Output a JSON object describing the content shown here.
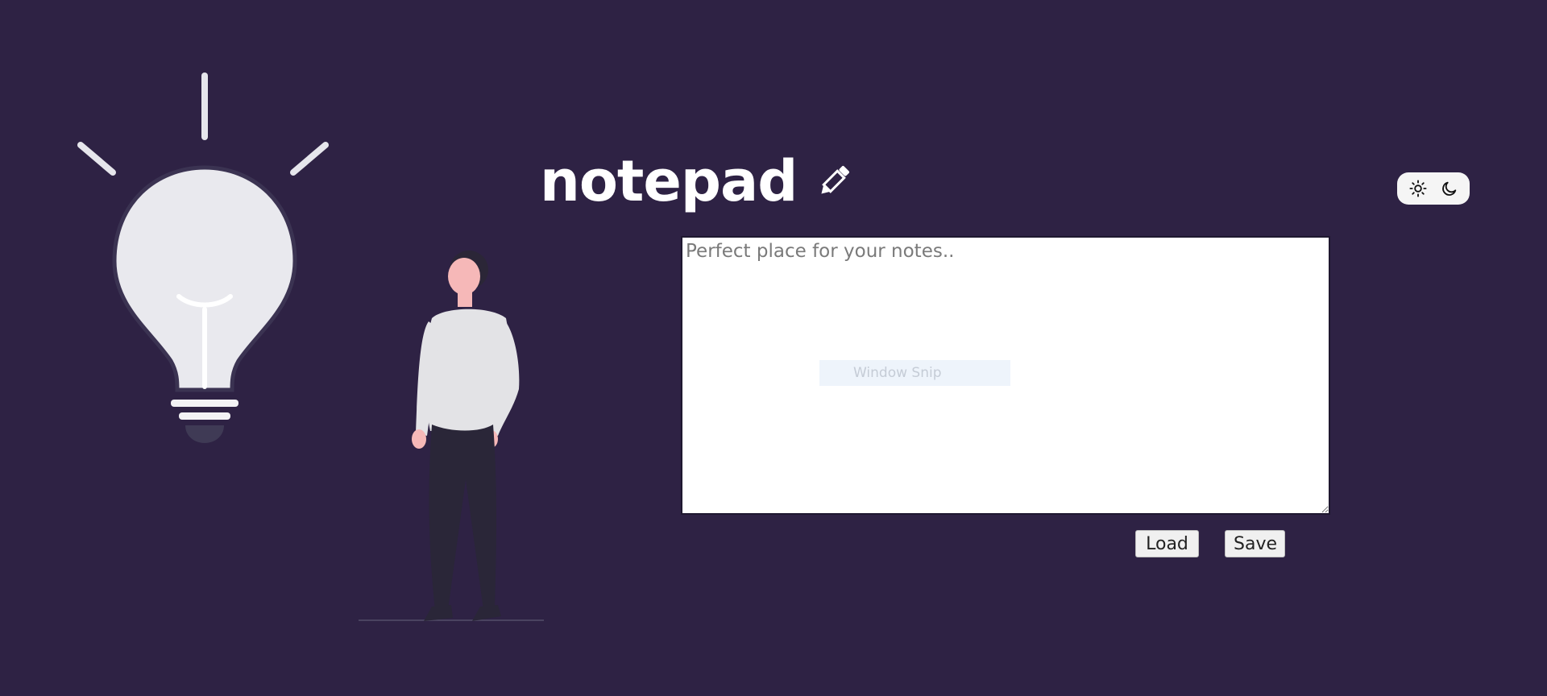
{
  "app": {
    "title": "notepad"
  },
  "editor": {
    "placeholder": "Perfect place for your notes..",
    "value": ""
  },
  "overlay": {
    "label": "Window Snip"
  },
  "buttons": {
    "load_label": "Load",
    "save_label": "Save"
  },
  "theme_toggle": {
    "options": [
      {
        "icon": "sun-icon"
      },
      {
        "icon": "moon-icon"
      }
    ]
  },
  "colors": {
    "background": "#2e2244",
    "editor_background": "#ffffff",
    "button_background": "#f0f0f0",
    "toggle_background": "#f5f5f5"
  }
}
